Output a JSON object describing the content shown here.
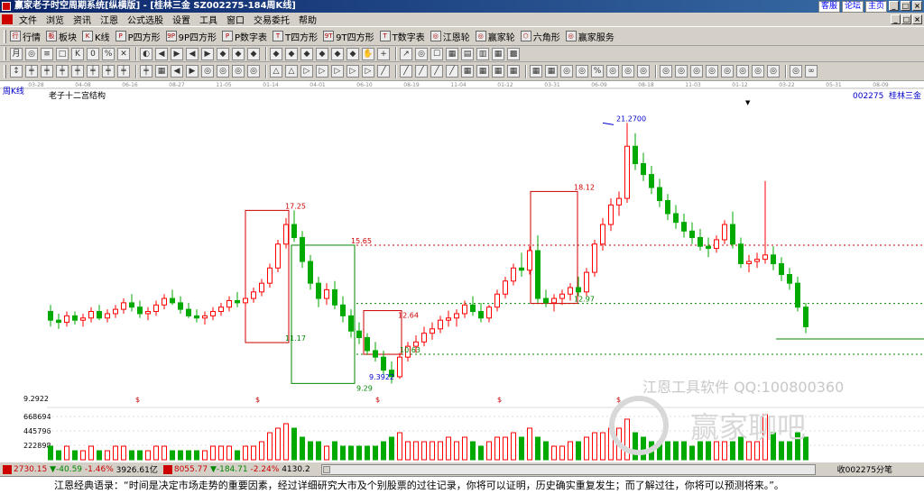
{
  "window": {
    "title": "赢家老子时空周期系统[纵横版] - [桂林三金  SZ002275-184周K线]",
    "links": [
      "客服",
      "论坛",
      "主页"
    ],
    "buttons": [
      "_",
      "□",
      "×"
    ]
  },
  "menu": [
    "文件",
    "浏览",
    "资讯",
    "江恩",
    "公式选股",
    "设置",
    "工具",
    "窗口",
    "交易委托",
    "帮助"
  ],
  "toolbar1": [
    {
      "label": "行情",
      "icon": "行"
    },
    {
      "label": "板块",
      "icon": "板"
    },
    {
      "label": "K线",
      "icon": "K"
    },
    {
      "label": "P四方形",
      "icon": "P"
    },
    {
      "label": "9P四方形",
      "icon": "9P"
    },
    {
      "label": "P数字表",
      "icon": "P"
    },
    {
      "label": "T四方形",
      "icon": "T"
    },
    {
      "label": "9T四方形",
      "icon": "9T"
    },
    {
      "label": "T数字表",
      "icon": "T"
    },
    {
      "label": "江恩轮",
      "icon": "◎"
    },
    {
      "label": "赢家轮",
      "icon": "◎"
    },
    {
      "label": "六角形",
      "icon": "⬡"
    },
    {
      "label": "赢家服务",
      "icon": "◎"
    }
  ],
  "toolbar2": [
    "月",
    "◎",
    "≡",
    "□",
    "K",
    "0",
    "%",
    "✕",
    "◐",
    "◀",
    "▶",
    "◀",
    "▶",
    "◆",
    "◆",
    "◆",
    "◆",
    "◆",
    "◆",
    "◆",
    "◆",
    "◆",
    "✋",
    "+",
    "↗",
    "◎",
    "☐",
    "▦",
    "▤",
    "▥",
    "▦",
    "▩"
  ],
  "toolbar3": [
    "↕",
    "╪",
    "╪",
    "╪",
    "╪",
    "╪",
    "╪",
    "╪",
    "╪",
    "▦",
    "◀",
    "▶",
    "◎",
    "◎",
    "◎",
    "◎",
    "△",
    "△",
    "▷",
    "▷",
    "▷",
    "▷",
    "▷",
    "╱",
    "╱",
    "╱",
    "╱",
    "╱",
    "▦",
    "▦",
    "▦",
    "▦",
    "▦",
    "▦",
    "◎",
    "◎",
    "%",
    "◎",
    "◎",
    "◎",
    "◎",
    "◎",
    "◎",
    "◎",
    "◎",
    "◎",
    "◎",
    "◎",
    "◎",
    "∞"
  ],
  "chart_header": {
    "period": "周K线",
    "structure": "老子十二宫结构",
    "code": "002275",
    "name": "桂林三金",
    "marker": "▼"
  },
  "chart_data": {
    "type": "candlestick",
    "title": "老子十二宫结构",
    "x_dates": [
      "03-28",
      "04-08",
      "06-16",
      "08-27",
      "11-05",
      "01-14",
      "04-01",
      "06-10",
      "08-19",
      "11-04",
      "01-12",
      "03-31",
      "06-09",
      "08-18",
      "11-03",
      "01-12",
      "03-22",
      "05-31",
      "08-09"
    ],
    "price_labels": [
      {
        "value": "21.2700",
        "price": 21.27
      },
      {
        "value": "18.12",
        "price": 18.12
      },
      {
        "value": "17.25",
        "price": 17.25
      },
      {
        "value": "15.65",
        "price": 15.65
      },
      {
        "value": "12.97",
        "price": 12.97
      },
      {
        "value": "12.64",
        "price": 12.64
      },
      {
        "value": "11.17",
        "price": 11.17
      },
      {
        "value": "10.63",
        "price": 10.63
      },
      {
        "value": "9.3922",
        "price": 9.39
      },
      {
        "value": "9.29",
        "price": 9.29
      }
    ],
    "left_label": "9.2922",
    "volume_axis": [
      "668694",
      "445796",
      "222898"
    ],
    "dollar_markers": [
      "$",
      "$",
      "$",
      "$",
      "$"
    ],
    "hlines": [
      {
        "price": 15.65,
        "color": "#c00"
      },
      {
        "price": 12.97,
        "color": "#080"
      },
      {
        "price": 10.63,
        "color": "#080"
      }
    ],
    "boxes": [
      {
        "price_top": 17.25,
        "price_bot": 11.17,
        "color": "#c00"
      },
      {
        "price_top": 15.65,
        "price_bot": 9.29,
        "color": "#080"
      },
      {
        "price_top": 12.64,
        "price_bot": 10.63,
        "color": "#c00"
      },
      {
        "price_top": 18.12,
        "price_bot": 12.97,
        "color": "#c00"
      }
    ],
    "candles": [
      [
        12.6,
        12.9,
        11.9,
        12.2
      ],
      [
        12.2,
        12.5,
        11.8,
        12.1
      ],
      [
        12.1,
        12.6,
        11.9,
        12.4
      ],
      [
        12.4,
        12.6,
        12.0,
        12.2
      ],
      [
        12.2,
        12.5,
        11.9,
        12.3
      ],
      [
        12.3,
        12.8,
        12.1,
        12.6
      ],
      [
        12.6,
        12.9,
        12.2,
        12.3
      ],
      [
        12.3,
        12.7,
        12.1,
        12.5
      ],
      [
        12.5,
        12.9,
        12.3,
        12.7
      ],
      [
        12.7,
        13.2,
        12.5,
        13.0
      ],
      [
        13.0,
        13.4,
        12.6,
        12.8
      ],
      [
        12.8,
        13.1,
        12.3,
        12.5
      ],
      [
        12.5,
        12.8,
        12.2,
        12.6
      ],
      [
        12.6,
        13.1,
        12.4,
        12.9
      ],
      [
        12.9,
        13.4,
        12.7,
        13.2
      ],
      [
        13.2,
        13.6,
        12.9,
        13.0
      ],
      [
        13.0,
        13.3,
        12.5,
        12.7
      ],
      [
        12.7,
        13.0,
        12.3,
        12.4
      ],
      [
        12.4,
        12.7,
        12.1,
        12.3
      ],
      [
        12.3,
        12.6,
        12.0,
        12.4
      ],
      [
        12.4,
        12.8,
        12.2,
        12.6
      ],
      [
        12.6,
        13.0,
        12.4,
        12.8
      ],
      [
        12.8,
        13.3,
        12.6,
        13.1
      ],
      [
        13.1,
        13.5,
        12.8,
        13.0
      ],
      [
        13.0,
        13.4,
        12.7,
        13.2
      ],
      [
        13.2,
        13.7,
        13.0,
        13.5
      ],
      [
        13.5,
        14.1,
        13.3,
        13.9
      ],
      [
        13.9,
        14.8,
        13.7,
        14.6
      ],
      [
        14.6,
        15.9,
        14.4,
        15.7
      ],
      [
        15.7,
        16.9,
        15.5,
        16.6
      ],
      [
        16.6,
        17.25,
        15.8,
        16.0
      ],
      [
        16.0,
        16.3,
        14.6,
        14.9
      ],
      [
        14.9,
        15.2,
        13.6,
        13.9
      ],
      [
        13.9,
        14.2,
        12.8,
        13.2
      ],
      [
        13.2,
        13.9,
        12.9,
        13.6
      ],
      [
        13.6,
        14.0,
        12.7,
        12.9
      ],
      [
        12.9,
        13.3,
        12.1,
        12.4
      ],
      [
        12.4,
        12.7,
        11.4,
        11.7
      ],
      [
        11.7,
        12.1,
        11.1,
        11.4
      ],
      [
        11.4,
        11.6,
        10.6,
        10.8
      ],
      [
        10.8,
        11.2,
        10.3,
        10.5
      ],
      [
        10.5,
        10.8,
        9.7,
        9.9
      ],
      [
        9.9,
        10.3,
        9.29,
        9.6
      ],
      [
        9.6,
        10.7,
        9.5,
        10.5
      ],
      [
        10.5,
        11.2,
        10.3,
        11.0
      ],
      [
        11.0,
        11.5,
        10.7,
        11.2
      ],
      [
        11.2,
        11.9,
        11.0,
        11.6
      ],
      [
        11.6,
        12.1,
        11.3,
        11.8
      ],
      [
        11.8,
        12.4,
        11.6,
        12.2
      ],
      [
        12.2,
        12.64,
        11.9,
        12.3
      ],
      [
        12.3,
        12.7,
        11.9,
        12.5
      ],
      [
        12.5,
        13.1,
        12.3,
        12.9
      ],
      [
        12.9,
        13.3,
        12.4,
        12.6
      ],
      [
        12.6,
        13.0,
        12.1,
        12.3
      ],
      [
        12.3,
        12.9,
        12.1,
        12.8
      ],
      [
        12.8,
        13.6,
        12.6,
        13.4
      ],
      [
        13.4,
        14.2,
        13.2,
        14.0
      ],
      [
        14.0,
        14.8,
        13.8,
        14.6
      ],
      [
        14.6,
        15.3,
        14.2,
        14.5
      ],
      [
        14.5,
        15.6,
        14.3,
        15.4
      ],
      [
        15.4,
        16.1,
        13.0,
        13.2
      ],
      [
        13.2,
        13.6,
        12.8,
        13.0
      ],
      [
        13.0,
        13.4,
        12.6,
        13.2
      ],
      [
        13.2,
        13.6,
        12.9,
        13.4
      ],
      [
        13.4,
        13.9,
        13.1,
        13.7
      ],
      [
        13.7,
        14.2,
        13.3,
        13.5
      ],
      [
        13.5,
        14.6,
        13.3,
        14.4
      ],
      [
        14.4,
        15.9,
        14.2,
        15.7
      ],
      [
        15.7,
        16.9,
        15.4,
        16.6
      ],
      [
        16.6,
        17.8,
        16.3,
        17.5
      ],
      [
        17.5,
        18.12,
        17.0,
        17.8
      ],
      [
        17.8,
        21.27,
        17.6,
        20.2
      ],
      [
        20.2,
        20.8,
        19.1,
        19.4
      ],
      [
        19.4,
        19.9,
        18.6,
        18.9
      ],
      [
        18.9,
        19.3,
        18.0,
        18.3
      ],
      [
        18.3,
        18.7,
        17.4,
        17.7
      ],
      [
        17.7,
        18.0,
        16.8,
        17.1
      ],
      [
        17.1,
        17.5,
        16.4,
        16.7
      ],
      [
        16.7,
        17.1,
        16.0,
        16.3
      ],
      [
        16.3,
        16.7,
        15.7,
        16.0
      ],
      [
        16.0,
        16.4,
        15.4,
        15.6
      ],
      [
        15.6,
        16.0,
        15.1,
        15.5
      ],
      [
        15.5,
        16.1,
        15.3,
        15.9
      ],
      [
        15.9,
        16.8,
        15.7,
        16.6
      ],
      [
        16.6,
        17.2,
        15.5,
        15.7
      ],
      [
        15.7,
        16.0,
        14.6,
        14.8
      ],
      [
        14.8,
        15.2,
        14.4,
        14.9
      ],
      [
        14.9,
        15.3,
        14.6,
        15.0
      ],
      [
        15.0,
        18.6,
        14.8,
        15.2
      ],
      [
        15.2,
        15.6,
        14.5,
        14.8
      ],
      [
        14.8,
        15.1,
        14.0,
        14.3
      ],
      [
        14.3,
        14.6,
        13.6,
        13.9
      ],
      [
        13.9,
        14.2,
        12.6,
        12.8
      ],
      [
        12.8,
        13.0,
        11.6,
        11.9
      ]
    ],
    "volumes": [
      3,
      2,
      3,
      2,
      2,
      3,
      2,
      2,
      3,
      3,
      2,
      2,
      2,
      3,
      3,
      2,
      2,
      2,
      2,
      2,
      3,
      3,
      3,
      2,
      3,
      3,
      4,
      6,
      7,
      8,
      7,
      5,
      4,
      4,
      3,
      4,
      3,
      3,
      3,
      3,
      3,
      4,
      5,
      6,
      4,
      4,
      4,
      4,
      4,
      5,
      4,
      5,
      4,
      3,
      4,
      5,
      5,
      6,
      5,
      7,
      5,
      4,
      3,
      3,
      4,
      4,
      5,
      6,
      6,
      7,
      7,
      9,
      6,
      5,
      4,
      4,
      4,
      4,
      4,
      3,
      4,
      4,
      4,
      4,
      4,
      5,
      4,
      4,
      10,
      6,
      4,
      4,
      6,
      5
    ]
  },
  "watermark": {
    "line1": "江恩工具软件 QQ:100800360",
    "line2": "赢家聊吧"
  },
  "status": {
    "sh_index": "2730.15",
    "sh_change": "▼-40.59",
    "sh_pct": "-1.46%",
    "sh_vol": "3926.61亿",
    "sz_index": "8055.77",
    "sz_change": "▼-184.71",
    "sz_pct": "-2.24%",
    "sz_vol": "4130.2",
    "right_info": "收002275分笔"
  },
  "quote": "江恩经典语录：“时间是决定市场走势的重要因素，经过详细研究大市及个别股票的过往记录，你将可以证明，历史确实重复发生；而了解过往，你将可以预测将来。”。"
}
